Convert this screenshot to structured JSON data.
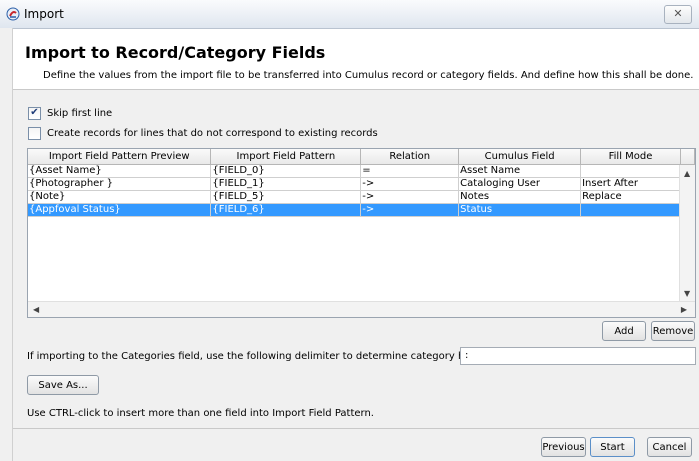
{
  "window": {
    "title": "Import",
    "close_glyph": "✕",
    "icon": "app-icon"
  },
  "header": {
    "title": "Import to Record/Category Fields",
    "description": "Define the values from the import file to be transferred into Cumulus record or category fields. And define how this shall be done."
  },
  "options": {
    "skip_first_line": {
      "label": "Skip first line",
      "checked": true
    },
    "create_records": {
      "label": "Create records for lines that do not correspond to existing records",
      "checked": false
    }
  },
  "table": {
    "columns": [
      "Import Field Pattern Preview",
      "Import Field Pattern",
      "Relation",
      "Cumulus Field",
      "Fill Mode"
    ],
    "rows": [
      [
        "{Asset Name}",
        "{FIELD_0}",
        "=",
        "Asset Name",
        ""
      ],
      [
        "{Photographer }",
        "{FIELD_1}",
        "->",
        "Cataloging User",
        "Insert After"
      ],
      [
        "{Note}",
        "{FIELD_5}",
        "->",
        "Notes",
        "Replace"
      ],
      [
        "{Appfoval Status}",
        "{FIELD_6}",
        "->",
        "Status",
        ""
      ]
    ],
    "selected_row": 3
  },
  "table_buttons": {
    "add": "Add",
    "remove": "Remove"
  },
  "delimiter": {
    "label": "If importing to the Categories field, use the following delimiter to determine category hierarchy levels:",
    "value": ":"
  },
  "save_as": "Save As...",
  "hint": "Use CTRL-click to insert more than one field into Import Field Pattern.",
  "footer": {
    "previous": "Previous",
    "start": "Start",
    "cancel": "Cancel"
  }
}
